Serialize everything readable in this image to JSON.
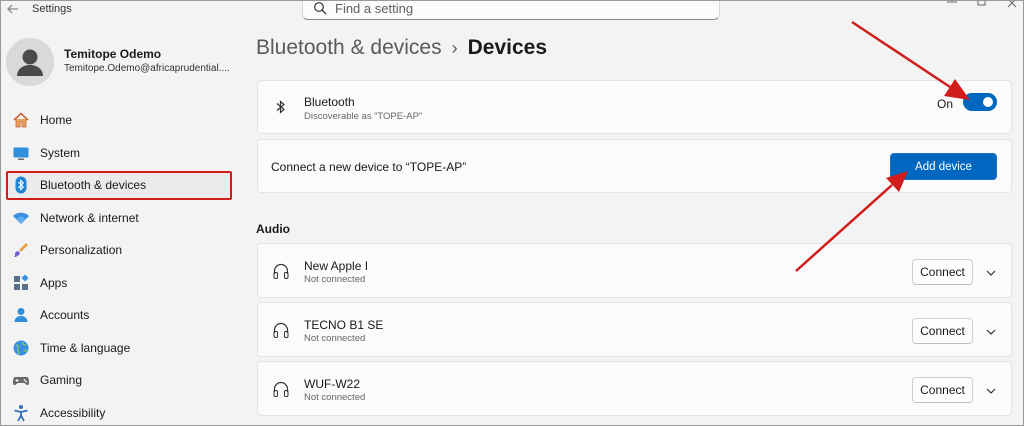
{
  "window": {
    "title": "Settings"
  },
  "search": {
    "placeholder": "Find a setting"
  },
  "profile": {
    "name": "Temitope Odemo",
    "email": "Temitope.Odemo@africaprudential...."
  },
  "sidebar": {
    "items": [
      {
        "label": "Home",
        "icon": "home-icon"
      },
      {
        "label": "System",
        "icon": "system-icon"
      },
      {
        "label": "Bluetooth & devices",
        "icon": "bluetooth-icon"
      },
      {
        "label": "Network & internet",
        "icon": "wifi-icon"
      },
      {
        "label": "Personalization",
        "icon": "brush-icon"
      },
      {
        "label": "Apps",
        "icon": "apps-icon"
      },
      {
        "label": "Accounts",
        "icon": "accounts-icon"
      },
      {
        "label": "Time & language",
        "icon": "globe-icon"
      },
      {
        "label": "Gaming",
        "icon": "gamepad-icon"
      },
      {
        "label": "Accessibility",
        "icon": "accessibility-icon"
      }
    ],
    "active": "Bluetooth & devices"
  },
  "breadcrumb": {
    "parent": "Bluetooth & devices",
    "separator": "›",
    "current": "Devices"
  },
  "bluetooth": {
    "title": "Bluetooth",
    "subtitle": "Discoverable as “TOPE-AP”",
    "state_label": "On",
    "enabled": true
  },
  "add_device": {
    "text": "Connect a new device to “TOPE-AP”",
    "button_label": "Add device"
  },
  "audio": {
    "section_label": "Audio",
    "devices": [
      {
        "name": "New Apple I",
        "status": "Not connected",
        "button_label": "Connect"
      },
      {
        "name": "TECNO B1 SE",
        "status": "Not connected",
        "button_label": "Connect"
      },
      {
        "name": "WUF-W22",
        "status": "Not connected",
        "button_label": "Connect"
      }
    ]
  },
  "colors": {
    "accent": "#0067c0",
    "annotation_red": "#d11c1c",
    "background": "#f3f3f3",
    "card": "#fbfbfb"
  }
}
